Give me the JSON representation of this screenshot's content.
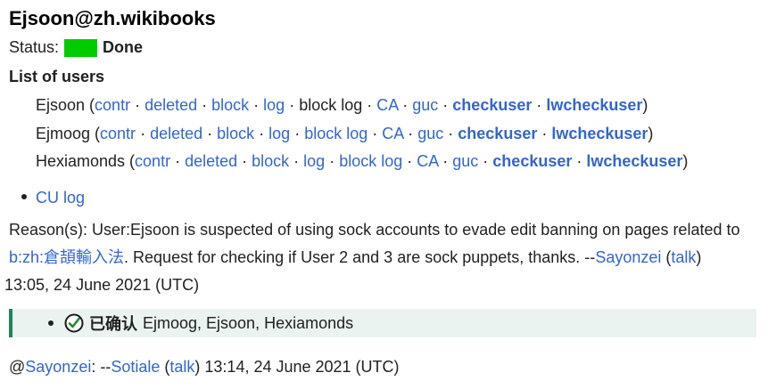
{
  "title": "Ejsoon@zh.wikibooks",
  "status": {
    "label": "Status:",
    "value": "Done",
    "color": "#00cc00"
  },
  "list_heading": "List of users",
  "users": [
    {
      "name": "Ejsoon",
      "open": " (",
      "close": ")",
      "links": [
        "contr",
        "deleted",
        "block",
        "log",
        "block log",
        "CA",
        "guc",
        "checkuser",
        "lwcheckuser"
      ]
    },
    {
      "name": "Ejmoog",
      "open": " (",
      "close": ")",
      "links": [
        "contr",
        "deleted",
        "block",
        "log",
        "block log",
        "CA",
        "guc",
        "checkuser",
        "lwcheckuser"
      ]
    },
    {
      "name": "Hexiamonds",
      "open": " (",
      "close": ")",
      "links": [
        "contr",
        "deleted",
        "block",
        "log",
        "block log",
        "CA",
        "guc",
        "checkuser",
        "lwcheckuser"
      ]
    }
  ],
  "separator": " · ",
  "cu_log": "CU log",
  "reason": {
    "prefix": "Reason(s): User:Ejsoon is suspected of using sock accounts to evade edit banning on pages related to ",
    "link": "b:zh:倉頡輸入法",
    "middle": ". Request for checking if User 2 and 3 are sock puppets, thanks. --",
    "sig_user": "Sayonzei",
    "talk_open": " (",
    "talk": "talk",
    "talk_close": ")",
    "timestamp": " 13:05, 24 June 2021 (UTC)"
  },
  "result": {
    "icon": "check-circle-icon",
    "label": "已确认",
    "users": "Ejmoog, Ejsoon, Hexiamonds",
    "accent": "#1e8558",
    "background": "#eaf3ef"
  },
  "footer": {
    "at": "@",
    "mention": "Sayonzei",
    "colon": ": --",
    "sig_user": "Sotiale",
    "talk_open": " (",
    "talk": "talk",
    "talk_close": ")",
    "timestamp": " 13:14, 24 June 2021 (UTC)"
  },
  "colors": {
    "link": "#3366cc",
    "text": "#202122"
  }
}
